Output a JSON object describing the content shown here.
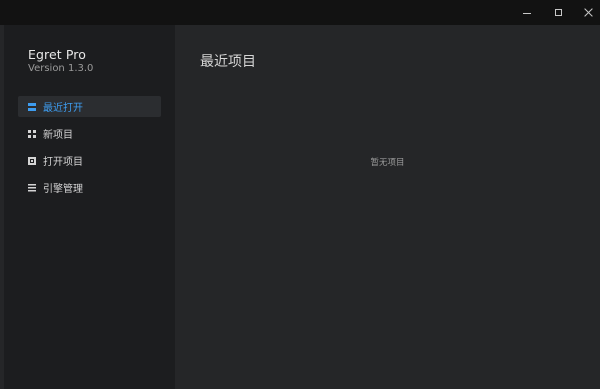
{
  "app": {
    "name": "Egret Pro",
    "version": "Version 1.3.0"
  },
  "window_controls": {
    "minimize_icon": "minimize-icon",
    "maximize_icon": "maximize-icon",
    "close_icon": "close-icon"
  },
  "sidebar": {
    "items": [
      {
        "label": "最近打开",
        "icon": "recent-icon",
        "active": true
      },
      {
        "label": "新项目",
        "icon": "grid-icon",
        "active": false
      },
      {
        "label": "打开项目",
        "icon": "open-project-icon",
        "active": false
      },
      {
        "label": "引擎管理",
        "icon": "list-icon",
        "active": false
      }
    ]
  },
  "main": {
    "title": "最近项目",
    "empty_text": "暂无项目"
  },
  "colors": {
    "accent": "#3e9df0",
    "sidebar_bg": "#1c1d1f",
    "main_bg": "#252628",
    "titlebar_bg": "#121212"
  }
}
